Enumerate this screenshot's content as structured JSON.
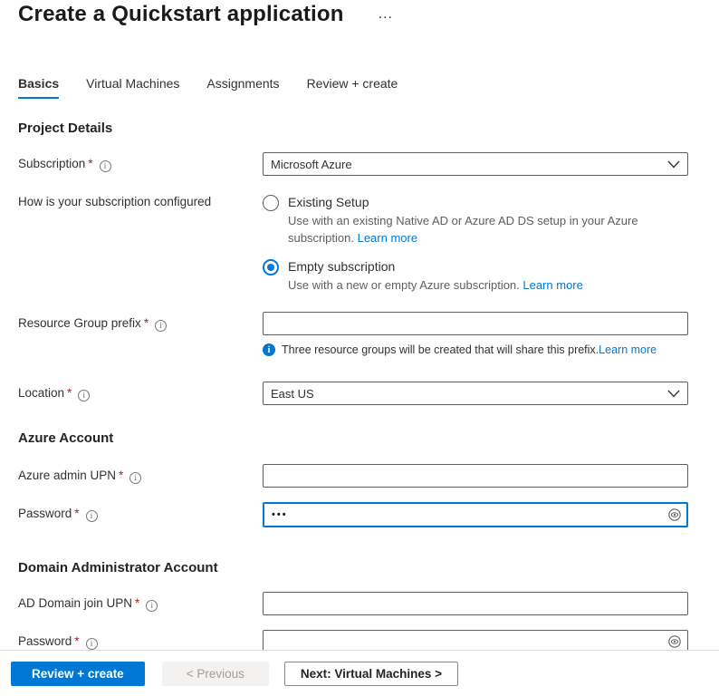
{
  "header": {
    "title": "Create a Quickstart application",
    "more_label": "..."
  },
  "tabs": [
    {
      "label": "Basics"
    },
    {
      "label": "Virtual Machines"
    },
    {
      "label": "Assignments"
    },
    {
      "label": "Review + create"
    }
  ],
  "sections": {
    "project_details": "Project Details",
    "azure_account": "Azure Account",
    "domain_admin": "Domain Administrator Account"
  },
  "fields": {
    "subscription": {
      "label": "Subscription",
      "required": "*",
      "value": "Microsoft Azure"
    },
    "subscription_config": {
      "label": "How is your subscription configured",
      "options": [
        {
          "label": "Existing Setup",
          "description": "Use with an existing Native AD or Azure AD DS setup in your Azure subscription. ",
          "link": "Learn more"
        },
        {
          "label": "Empty subscription",
          "description": "Use with a new or empty Azure subscription. ",
          "link": "Learn more"
        }
      ]
    },
    "resource_group_prefix": {
      "label": "Resource Group prefix",
      "required": "*",
      "value": "",
      "info_text": "Three resource groups will be created that will share this prefix.",
      "info_link": "Learn more"
    },
    "location": {
      "label": "Location",
      "required": "*",
      "value": "East US"
    },
    "azure_admin_upn": {
      "label": "Azure admin UPN",
      "required": "*",
      "value": ""
    },
    "azure_password": {
      "label": "Password",
      "required": "*",
      "value": "•••"
    },
    "ad_domain_join_upn": {
      "label": "AD Domain join UPN",
      "required": "*",
      "value": ""
    },
    "domain_password": {
      "label": "Password",
      "required": "*",
      "value": ""
    }
  },
  "footer": {
    "review_create": "Review + create",
    "previous": "< Previous",
    "next": "Next: Virtual Machines >"
  },
  "colors": {
    "accent": "#0078d4",
    "required": "#a4262c",
    "label": "#323130",
    "secondary_text": "#605e5c"
  }
}
